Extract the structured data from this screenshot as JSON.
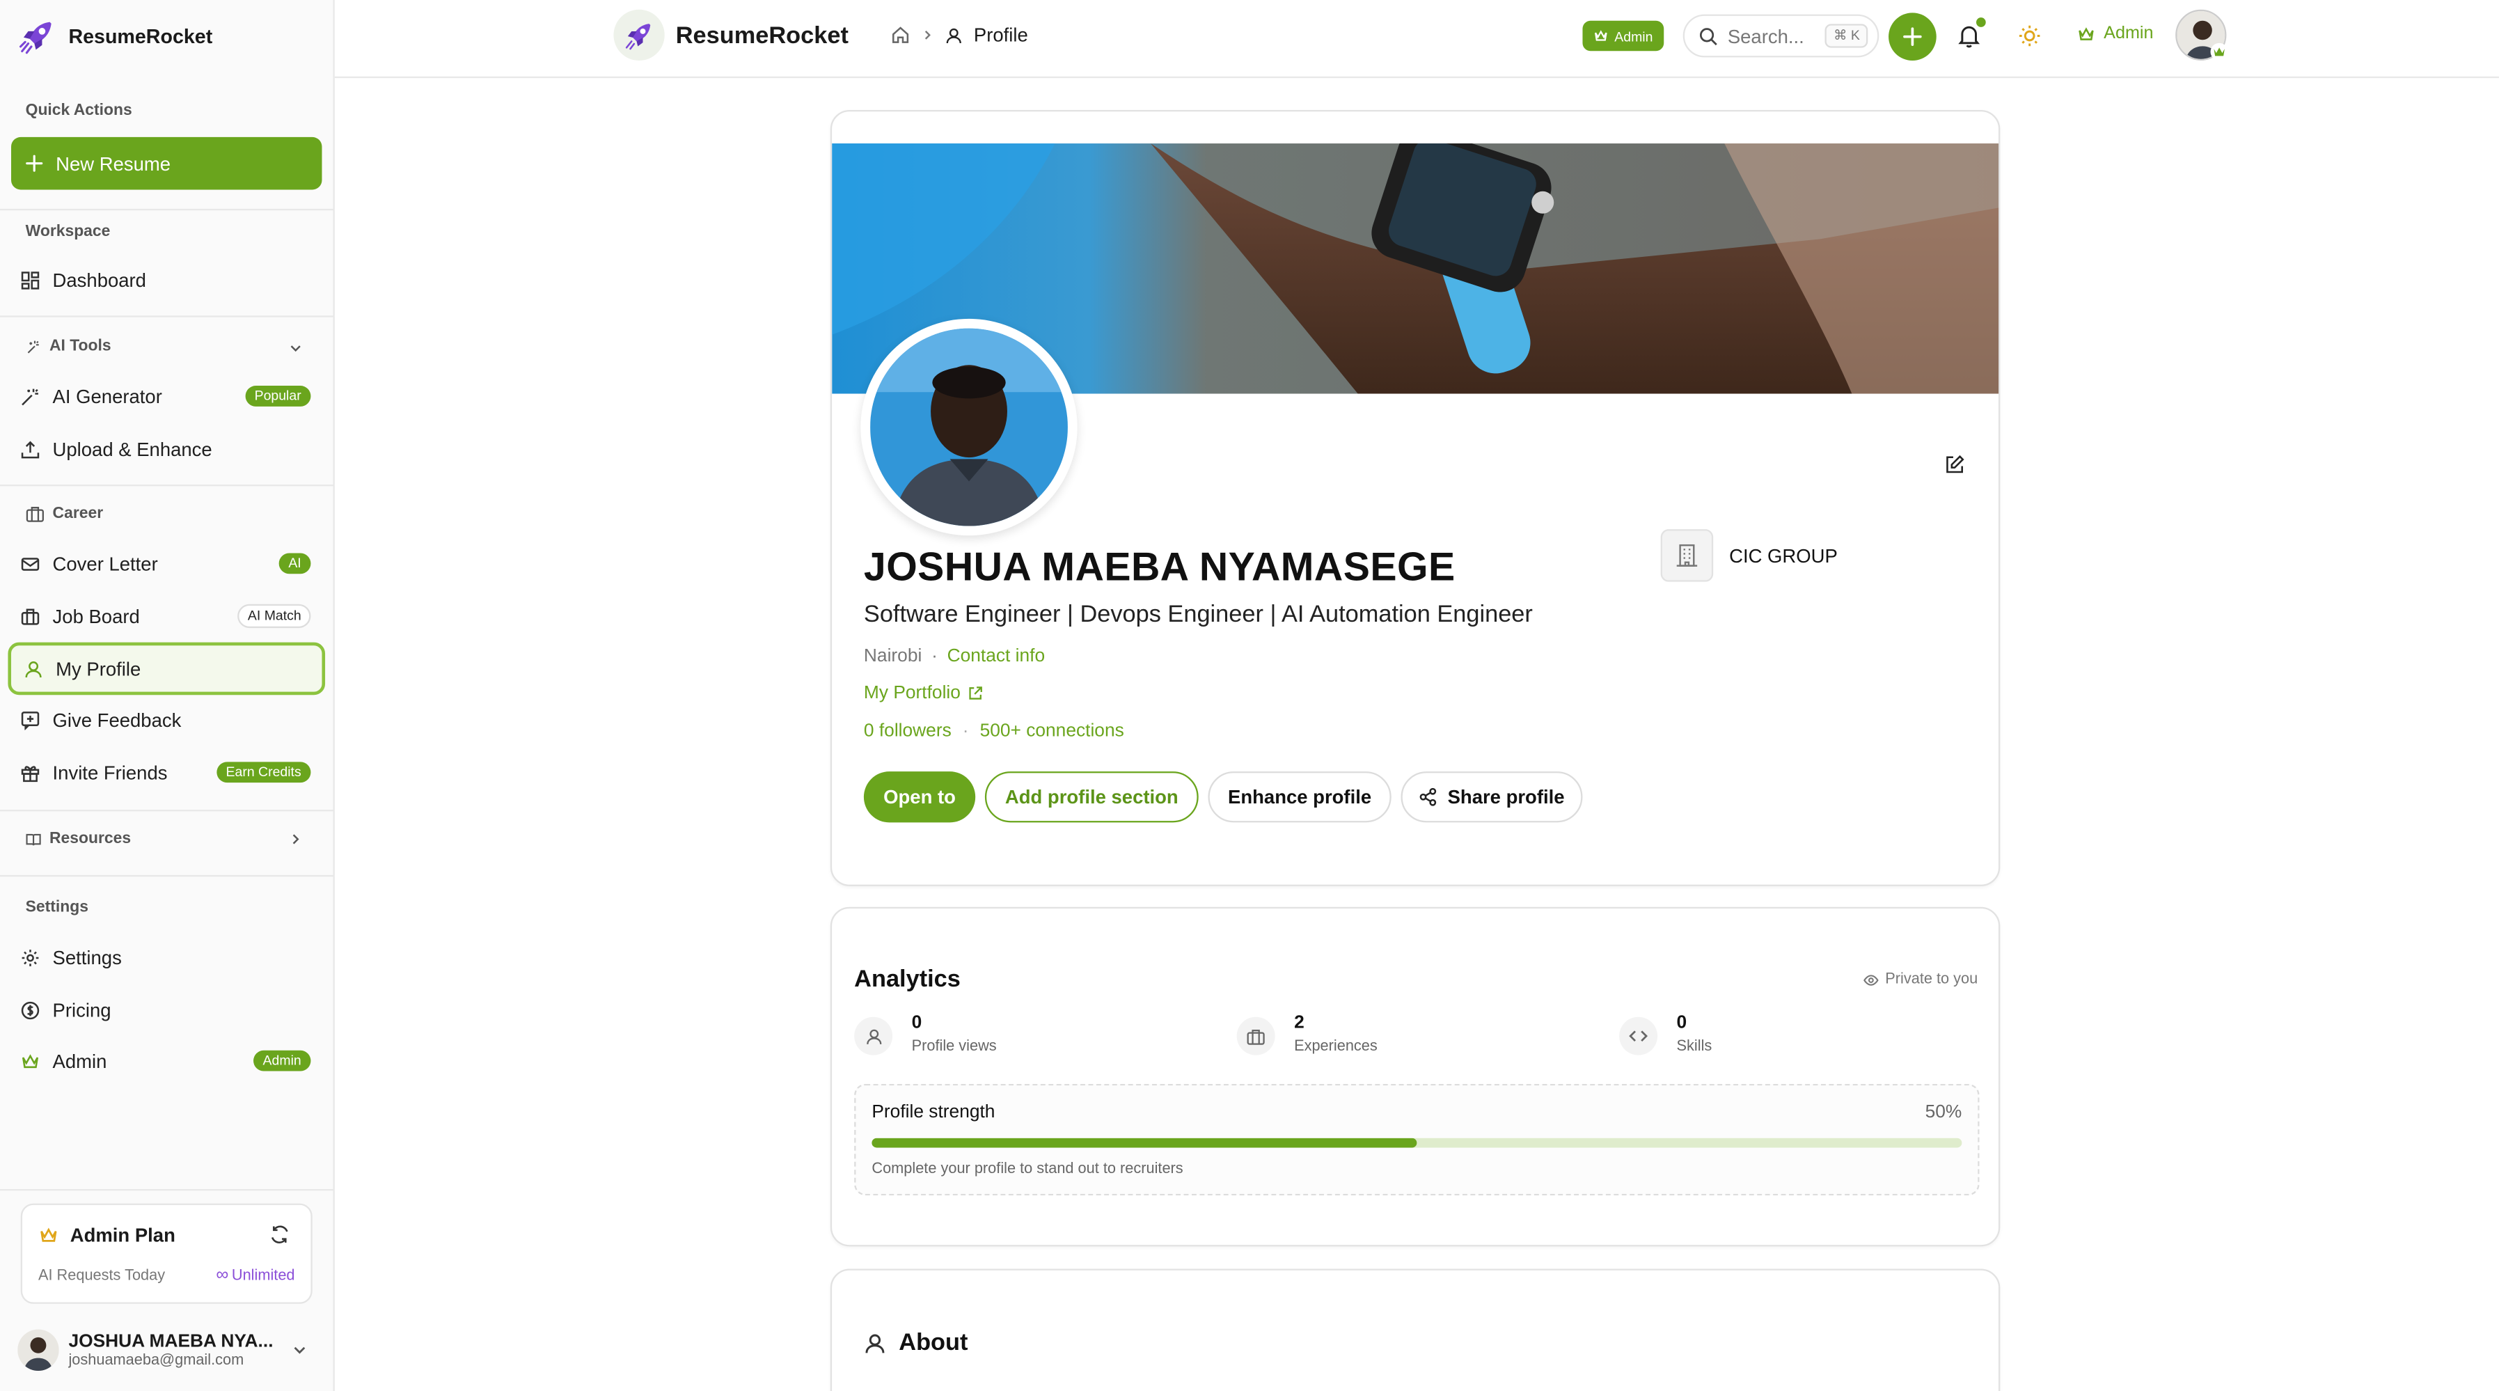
{
  "app": {
    "name": "ResumeRocket"
  },
  "sidebar": {
    "quick_actions_label": "Quick Actions",
    "new_resume_label": "New Resume",
    "workspace_label": "Workspace",
    "dashboard_label": "Dashboard",
    "ai_tools_label": "AI Tools",
    "ai_generator_label": "AI Generator",
    "ai_generator_badge": "Popular",
    "upload_label": "Upload & Enhance",
    "career_label": "Career",
    "cover_letter_label": "Cover Letter",
    "cover_letter_badge": "AI",
    "job_board_label": "Job Board",
    "job_board_badge": "AI Match",
    "my_profile_label": "My Profile",
    "feedback_label": "Give Feedback",
    "invite_label": "Invite Friends",
    "invite_badge": "Earn Credits",
    "resources_label": "Resources",
    "settings_section_label": "Settings",
    "settings_label": "Settings",
    "pricing_label": "Pricing",
    "admin_label": "Admin",
    "admin_badge": "Admin",
    "plan": {
      "title": "Admin Plan",
      "requests_label": "AI Requests Today",
      "requests_value": "Unlimited"
    },
    "user": {
      "name": "JOSHUA MAEBA NYA...",
      "email": "joshuamaeba@gmail.com"
    }
  },
  "topbar": {
    "breadcrumb_current": "Profile",
    "admin_badge": "Admin",
    "search_placeholder": "Search...",
    "search_shortcut": "⌘ K",
    "admin_link": "Admin"
  },
  "profile": {
    "name": "JOSHUA MAEBA NYAMASEGE",
    "headline": "Software Engineer | Devops Engineer | AI Automation Engineer",
    "location": "Nairobi",
    "contact_info": "Contact info",
    "portfolio": "My Portfolio",
    "followers": "0 followers",
    "connections": "500+ connections",
    "company": "CIC GROUP",
    "buttons": {
      "open_to": "Open to",
      "add_section": "Add profile section",
      "enhance": "Enhance profile",
      "share": "Share profile"
    }
  },
  "analytics": {
    "title": "Analytics",
    "private_label": "Private to you",
    "stats": [
      {
        "value": "0",
        "label": "Profile views"
      },
      {
        "value": "2",
        "label": "Experiences"
      },
      {
        "value": "0",
        "label": "Skills"
      }
    ],
    "strength": {
      "title": "Profile strength",
      "percent_label": "50%",
      "percent": 0.5,
      "note": "Complete your profile to stand out to recruiters"
    }
  },
  "about": {
    "title": "About"
  },
  "colors": {
    "accent": "#6aa51d",
    "accent_light": "#dfeccc",
    "purple": "#8b4fd8"
  }
}
